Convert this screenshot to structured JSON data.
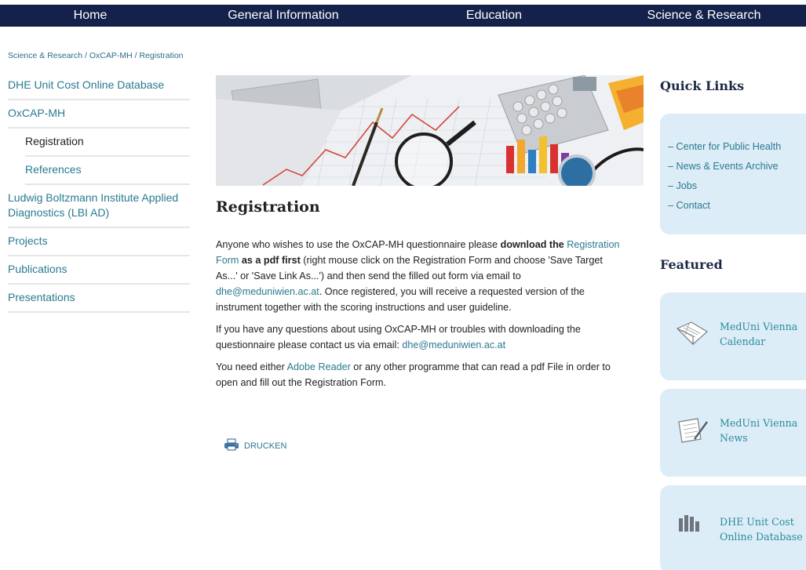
{
  "nav": {
    "items": [
      {
        "label": "Home"
      },
      {
        "label": "General Information"
      },
      {
        "label": "Education"
      },
      {
        "label": "Science & Research"
      }
    ]
  },
  "breadcrumb": "Science & Research / OxCAP-MH / Registration",
  "sidebar": {
    "items": [
      {
        "label": "DHE Unit Cost Online Database"
      },
      {
        "label": "OxCAP-MH"
      },
      {
        "label": "Registration"
      },
      {
        "label": "References"
      },
      {
        "label": "Ludwig Boltzmann Institute Applied Diagnostics (LBI AD)"
      },
      {
        "label": "Projects"
      },
      {
        "label": "Publications"
      },
      {
        "label": "Presentations"
      }
    ]
  },
  "main": {
    "title": "Registration",
    "p1": {
      "t1": "Anyone who wishes to use the OxCAP-MH questionnaire please ",
      "b1": "download the",
      "link1": "Registration Form",
      "b2": " as a pdf first",
      "t2": " (right mouse click on the Registration Form and choose 'Save Target As...' or 'Save Link As...') and then send the filled out form via email to ",
      "link2": "dhe@meduniwien.ac.at",
      "t3": ". Once registered, you will receive a requested version of the instrument together with the scoring instructions and user guideline."
    },
    "p2": {
      "t1": "If you have any questions about using OxCAP-MH or troubles with downloading the questionnaire please contact us via email: ",
      "link": "dhe@meduniwien.ac.at"
    },
    "p3": {
      "t1": "You need either ",
      "link": "Adobe Reader",
      "t2": " or any other programme that can read a pdf File in order to open and fill out the Registration Form."
    },
    "print_label": "DRUCKEN"
  },
  "quick_links": {
    "title": "Quick Links",
    "items": [
      {
        "label": "– Center for Public Health"
      },
      {
        "label": "– News & Events Archive"
      },
      {
        "label": "– Jobs"
      },
      {
        "label": "– Contact"
      }
    ]
  },
  "featured": {
    "title": "Featured",
    "items": [
      {
        "label": "MedUni Vienna Calendar",
        "icon": "calendar-icon"
      },
      {
        "label": "MedUni Vienna News",
        "icon": "news-icon"
      },
      {
        "label": "DHE Unit Cost Online Database",
        "icon": "database-icon"
      }
    ]
  },
  "colors": {
    "nav_bg": "#14214a",
    "link": "#2a7a90",
    "box_bg": "#ddedf7"
  }
}
